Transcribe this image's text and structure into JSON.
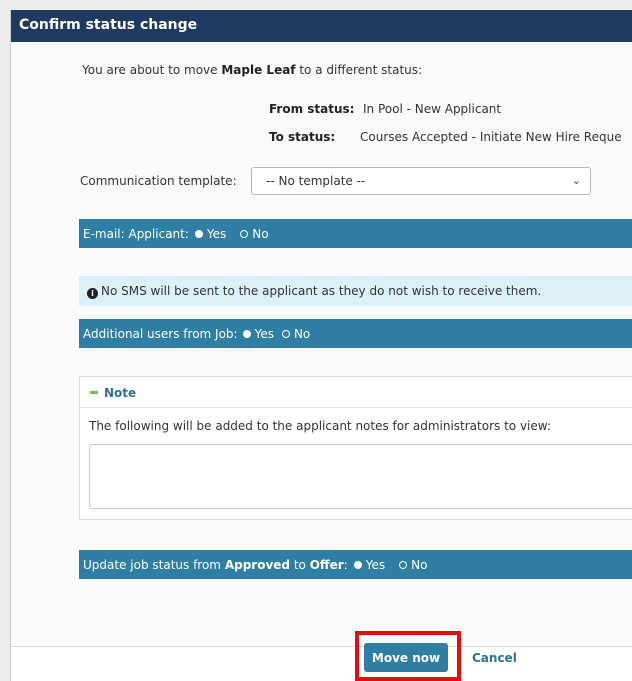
{
  "dialog": {
    "title": "Confirm status change",
    "intro_prefix": "You are about to move ",
    "applicant_name": "Maple Leaf",
    "intro_suffix": " to a different status:",
    "from_label": "From status:",
    "from_value": "In Pool - New Applicant",
    "to_label": "To status:",
    "to_value": "Courses Accepted - Initiate New Hire Reque",
    "template_label": "Communication template:",
    "template_selected": "-- No template --"
  },
  "email_band": {
    "label": "E-mail: Applicant:",
    "yes": "Yes",
    "no": "No"
  },
  "sms_info": {
    "text": "No SMS will be sent to the applicant as they do not wish to receive them."
  },
  "users_band": {
    "label": "Additional users from Job:",
    "yes": "Yes",
    "no": "No"
  },
  "note": {
    "title": "Note",
    "description": "The following will be added to the applicant notes for administrators to view:",
    "value": ""
  },
  "update_band": {
    "prefix": "Update job status from ",
    "from": "Approved",
    "middle": " to ",
    "to": "Offer",
    "suffix": ":",
    "yes": "Yes",
    "no": "No"
  },
  "footer": {
    "move_label": "Move now",
    "cancel_label": "Cancel"
  },
  "colors": {
    "header": "#1f3a60",
    "band": "#2f7ea3",
    "info_bg": "#dcf0f8",
    "highlight": "#e01010"
  }
}
